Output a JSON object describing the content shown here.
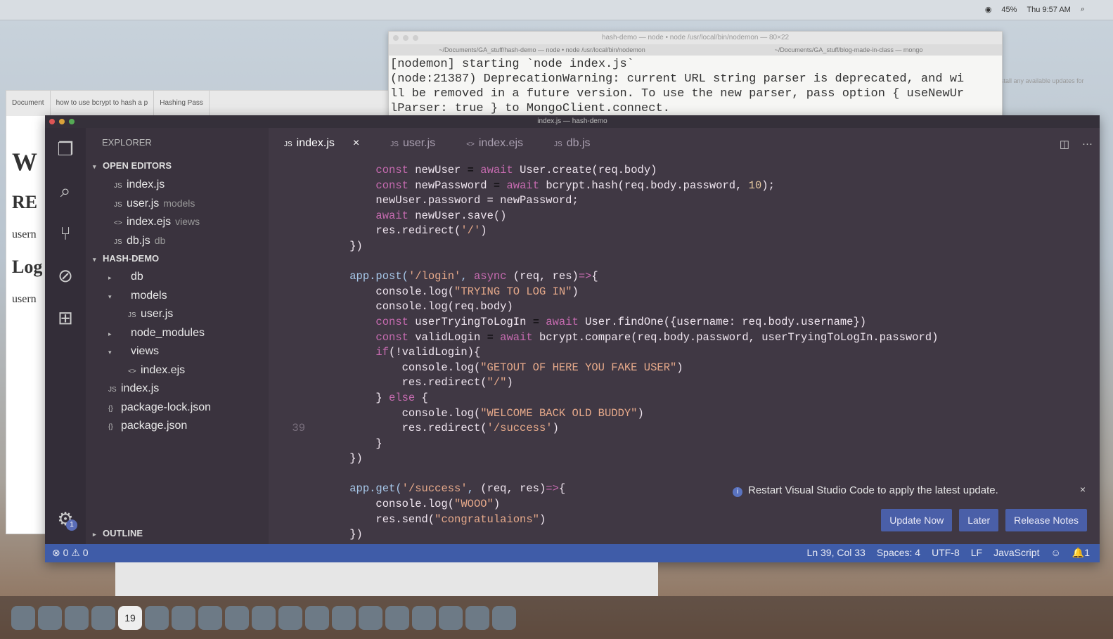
{
  "menubar": {
    "battery": "45%",
    "clock": "Thu 9:57 AM"
  },
  "terminal": {
    "title": "hash-demo — node • node /usr/local/bin/nodemon — 80×22",
    "tab1": "~/Documents/GA_stuff/hash-demo — node • node /usr/local/bin/nodemon",
    "tab2": "~/Documents/GA_stuff/blog-made-in-class — mongo",
    "output": "[nodemon] starting `node index.js`\n(node:21387) DeprecationWarning: current URL string parser is deprecated, and wi\nll be removed in a future version. To use the new parser, pass option { useNewUr\nlParser: true } to MongoClient.connect."
  },
  "browser": {
    "tabs": [
      "Document",
      "how to use bcrypt to hash a p",
      "Hashing Pass"
    ],
    "page_lines": [
      "W",
      "RE",
      "usern",
      "Log",
      "usern"
    ]
  },
  "right_doc_text": "install any available updates for",
  "vscode": {
    "title": "index.js — hash-demo",
    "sidebar": {
      "header": "EXPLORER",
      "open_editors_label": "OPEN EDITORS",
      "open_editors": [
        {
          "type": "JS",
          "name": "index.js",
          "dir": ""
        },
        {
          "type": "JS",
          "name": "user.js",
          "dir": "models"
        },
        {
          "type": "<>",
          "name": "index.ejs",
          "dir": "views"
        },
        {
          "type": "JS",
          "name": "db.js",
          "dir": "db"
        }
      ],
      "project_label": "HASH-DEMO",
      "tree": [
        {
          "indent": 1,
          "tri": "▸",
          "type": "",
          "name": "db"
        },
        {
          "indent": 1,
          "tri": "▾",
          "type": "",
          "name": "models"
        },
        {
          "indent": 2,
          "tri": "",
          "type": "JS",
          "name": "user.js"
        },
        {
          "indent": 1,
          "tri": "▸",
          "type": "",
          "name": "node_modules"
        },
        {
          "indent": 1,
          "tri": "▾",
          "type": "",
          "name": "views"
        },
        {
          "indent": 2,
          "tri": "",
          "type": "<>",
          "name": "index.ejs"
        },
        {
          "indent": 0,
          "tri": "",
          "type": "JS",
          "name": "index.js"
        },
        {
          "indent": 0,
          "tri": "",
          "type": "{}",
          "name": "package-lock.json"
        },
        {
          "indent": 0,
          "tri": "",
          "type": "{}",
          "name": "package.json"
        }
      ],
      "outline_label": "OUTLINE"
    },
    "tabs": [
      {
        "type": "JS",
        "label": "index.js",
        "active": true
      },
      {
        "type": "JS",
        "label": "user.js",
        "active": false
      },
      {
        "type": "<>",
        "label": "index.ejs",
        "active": false
      },
      {
        "type": "JS",
        "label": "db.js",
        "active": false
      }
    ],
    "tab_close": "×",
    "code_lines": [
      {
        "n": "",
        "html": "        <span class='c-k'>const</span> <span class='c-t'>newUser</span> = <span class='c-k'>await</span> <span class='c-t'>User.create(req.body)</span>"
      },
      {
        "n": "",
        "html": "        <span class='c-k'>const</span> <span class='c-t'>newPassword</span> = <span class='c-k'>await</span> <span class='c-t'>bcrypt.hash(req.body.password, </span><span class='c-n'>10</span><span class='c-t'>);</span>"
      },
      {
        "n": "",
        "html": "        <span class='c-t'>newUser.password = newPassword;</span>"
      },
      {
        "n": "",
        "html": "        <span class='c-k'>await</span> <span class='c-t'>newUser.save()</span>"
      },
      {
        "n": "",
        "html": "        <span class='c-t'>res.redirect(</span><span class='c-s'>'/'</span><span class='c-t'>)</span>"
      },
      {
        "n": "",
        "html": "    <span class='c-t'>})</span>"
      },
      {
        "n": "",
        "html": ""
      },
      {
        "n": "",
        "html": "    <span class='c-f'>app.post(</span><span class='c-s'>'/login'</span><span class='c-f'>, </span><span class='c-k'>async</span> <span class='c-t'>(req, res)</span><span class='c-k'>=></span><span class='c-t'>{</span>"
      },
      {
        "n": "",
        "html": "        <span class='c-t'>console.log(</span><span class='c-s'>\"TRYING TO LOG IN\"</span><span class='c-t'>)</span>"
      },
      {
        "n": "",
        "html": "        <span class='c-t'>console.log(req.body)</span>"
      },
      {
        "n": "",
        "html": "        <span class='c-k'>const</span> <span class='c-t'>userTryingToLogIn</span> = <span class='c-k'>await</span> <span class='c-t'>User.findOne({username: req.body.username})</span>"
      },
      {
        "n": "",
        "html": "        <span class='c-k'>const</span> <span class='c-t'>validLogin</span> = <span class='c-k'>await</span> <span class='c-t'>bcrypt.compare(req.body.password, userTryingToLogIn.password)</span>"
      },
      {
        "n": "",
        "html": "        <span class='c-k'>if</span><span class='c-t'>(!validLogin){</span>"
      },
      {
        "n": "",
        "html": "            <span class='c-t'>console.log(</span><span class='c-s'>\"GETOUT OF HERE YOU FAKE USER\"</span><span class='c-t'>)</span>"
      },
      {
        "n": "",
        "html": "            <span class='c-t'>res.redirect(</span><span class='c-s'>\"/\"</span><span class='c-t'>)</span>"
      },
      {
        "n": "",
        "html": "        <span class='c-t'>} </span><span class='c-k'>else</span><span class='c-t'> {</span>"
      },
      {
        "n": "",
        "html": "            <span class='c-t'>console.log(</span><span class='c-s'>\"WELCOME BACK OLD BUDDY\"</span><span class='c-t'>)</span>"
      },
      {
        "n": "39",
        "html": "            <span class='c-t'>res.redirect(</span><span class='c-s'>'/success'</span><span class='c-t'>)</span>"
      },
      {
        "n": "",
        "html": "        <span class='c-t'>}</span>"
      },
      {
        "n": "",
        "html": "    <span class='c-t'>})</span>"
      },
      {
        "n": "",
        "html": ""
      },
      {
        "n": "",
        "html": "    <span class='c-f'>app.get(</span><span class='c-s'>'/success'</span><span class='c-f'>, </span><span class='c-t'>(req, res)</span><span class='c-k'>=></span><span class='c-t'>{</span>"
      },
      {
        "n": "",
        "html": "        <span class='c-t'>console.log(</span><span class='c-s'>\"WOOO\"</span><span class='c-t'>)</span>"
      },
      {
        "n": "",
        "html": "        <span class='c-t'>res.send(</span><span class='c-s'>\"congratulaions\"</span><span class='c-t'>)</span>"
      },
      {
        "n": "",
        "html": "    <span class='c-t'>})</span>"
      }
    ],
    "notification": {
      "message": "Restart Visual Studio Code to apply the latest update.",
      "info_icon": "i",
      "buttons": [
        "Update Now",
        "Later",
        "Release Notes"
      ],
      "close": "×"
    },
    "settings_badge": "1",
    "statusbar": {
      "errors": "⊗ 0 ⚠ 0",
      "position": "Ln 39, Col 33",
      "spaces": "Spaces: 4",
      "encoding": "UTF-8",
      "eol": "LF",
      "language": "JavaScript",
      "bell": "1"
    }
  },
  "dock": {
    "calendar_day": "19"
  }
}
